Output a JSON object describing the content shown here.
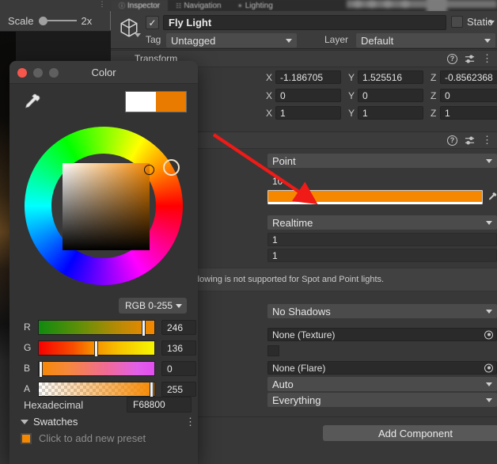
{
  "scene_toolbar": {
    "scale_label": "Scale",
    "scale_value": "2x",
    "kebab": "⋮"
  },
  "inspector": {
    "tabs": [
      {
        "label": "Inspector",
        "icon": "info-icon",
        "active": true
      },
      {
        "label": "Navigation",
        "icon": "navigation-icon",
        "active": false
      },
      {
        "label": "Lighting",
        "icon": "lighting-icon",
        "active": false
      }
    ],
    "object": {
      "name": "Fly Light",
      "enabled_check": "✓",
      "static_label": "Static",
      "tag_label": "Tag",
      "tag_value": "Untagged",
      "layer_label": "Layer",
      "layer_value": "Default"
    },
    "transform": {
      "title": "Transform",
      "help_icon": "?",
      "kebab_icon": "⋮",
      "rows": [
        {
          "x_label": "X",
          "x": "-1.186705",
          "y_label": "Y",
          "y": "1.525516",
          "z_label": "Z",
          "z": "-0.8562368"
        },
        {
          "x_label": "X",
          "x": "0",
          "y_label": "Y",
          "y": "0",
          "z_label": "Z",
          "z": "0"
        },
        {
          "x_label": "X",
          "x": "1",
          "y_label": "Y",
          "y": "1",
          "z_label": "Z",
          "z": "1"
        }
      ]
    },
    "light": {
      "type_value": "Point",
      "range_value": "10",
      "color_value": "#F68800",
      "mode_value": "Realtime",
      "intensity_value": "1",
      "bounce_value": "1",
      "info_text": "Indirect bounce shadowing is not supported for Spot and Point lights.",
      "shadow_type_value": "No Shadows",
      "cookie_value": "None (Texture)",
      "flare_value": "None (Flare)",
      "render_mode_value": "Auto",
      "culling_mask_value": "Everything"
    },
    "add_component_label": "Add Component"
  },
  "color_picker": {
    "title": "Color",
    "eyedropper_icon": "eyedropper-icon",
    "mode_label": "RGB 0-255",
    "channels": [
      {
        "label": "R",
        "value": "246",
        "pos": 89
      },
      {
        "label": "G",
        "value": "136",
        "pos": 48
      },
      {
        "label": "B",
        "value": "0",
        "pos": 0
      },
      {
        "label": "A",
        "value": "255",
        "pos": 96
      }
    ],
    "hex_label": "Hexadecimal",
    "hex_value": "F68800",
    "swatches_label": "Swatches",
    "swatches_kebab": "⋮",
    "preset_text": "Click to add new preset",
    "preview_old": "#FFFFFF",
    "preview_new": "#E87B00"
  },
  "annotation": {
    "arrow_color": "#F01A17"
  }
}
